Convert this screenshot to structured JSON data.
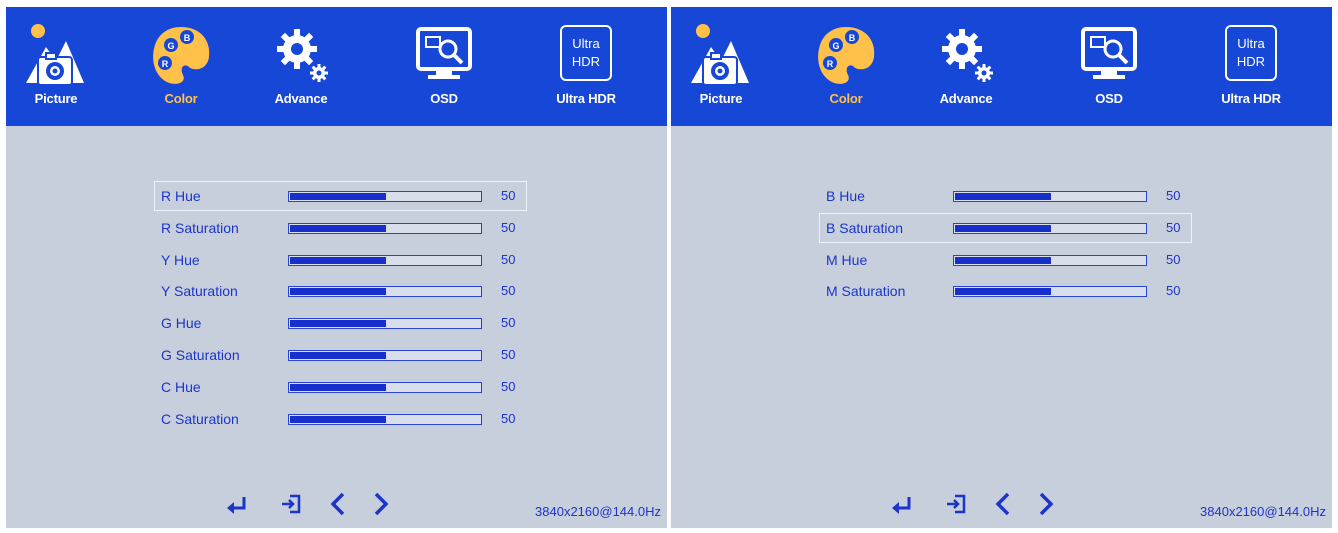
{
  "tabs": [
    "Picture",
    "Color",
    "Advance",
    "OSD",
    "Ultra HDR"
  ],
  "ultra_hdr_icon": {
    "line1": "Ultra",
    "line2": "HDR"
  },
  "color_badges": {
    "left": [
      "G",
      "B",
      "R"
    ],
    "right": [
      "G",
      "B",
      "R"
    ]
  },
  "colors": {
    "bar": "#1747d6",
    "panel": "#c8cfdc",
    "text": "#1b35c8",
    "accent": "#ffc14a"
  },
  "left_panel": {
    "active_tab": "Color",
    "rows": [
      {
        "name": "R Hue",
        "value": "50",
        "level": 0.5,
        "selected": true
      },
      {
        "name": "R Saturation",
        "value": "50",
        "level": 0.5,
        "selected": false
      },
      {
        "name": "Y Hue",
        "value": "50",
        "level": 0.5,
        "selected": false
      },
      {
        "name": "Y Saturation",
        "value": "50",
        "level": 0.5,
        "selected": false
      },
      {
        "name": "G Hue",
        "value": "50",
        "level": 0.5,
        "selected": false
      },
      {
        "name": "G Saturation",
        "value": "50",
        "level": 0.5,
        "selected": false
      },
      {
        "name": "C Hue",
        "value": "50",
        "level": 0.5,
        "selected": false
      },
      {
        "name": "C Saturation",
        "value": "50",
        "level": 0.5,
        "selected": false
      }
    ],
    "resolution": "3840x2160@144.0Hz"
  },
  "right_panel": {
    "active_tab": "Color",
    "rows": [
      {
        "name": "B Hue",
        "value": "50",
        "level": 0.5,
        "selected": false
      },
      {
        "name": "B Saturation",
        "value": "50",
        "level": 0.5,
        "selected": true
      },
      {
        "name": "M Hue",
        "value": "50",
        "level": 0.5,
        "selected": false
      },
      {
        "name": "M Saturation",
        "value": "50",
        "level": 0.5,
        "selected": false
      }
    ],
    "resolution": "3840x2160@144.0Hz"
  },
  "footer_icons": [
    "enter-icon",
    "exit-icon",
    "left-arrow-icon",
    "right-arrow-icon"
  ]
}
